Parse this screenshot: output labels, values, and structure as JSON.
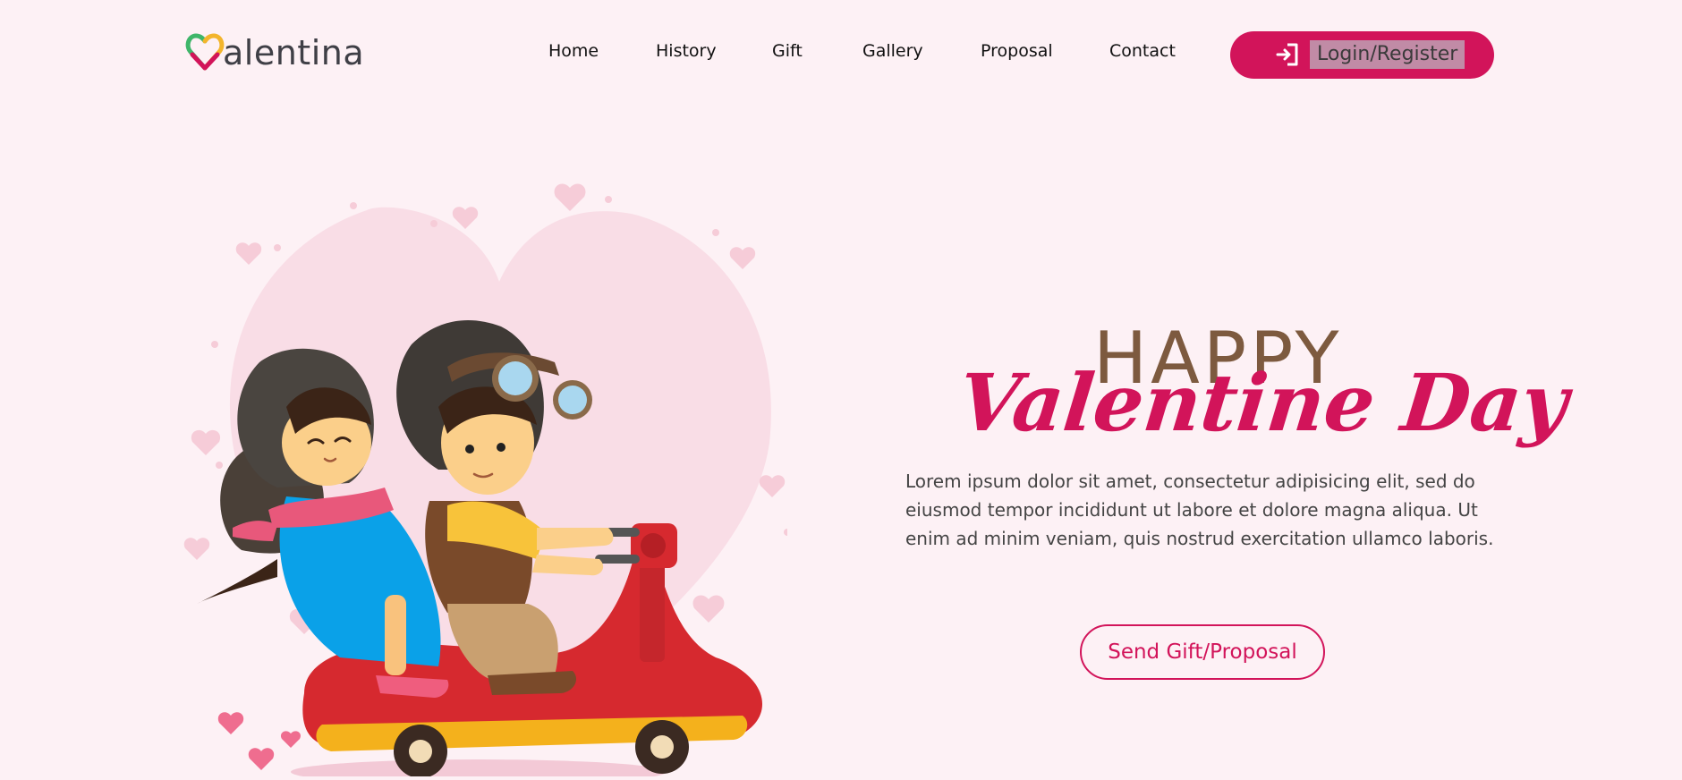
{
  "brand": {
    "logo_text": "alentina",
    "colors": {
      "primary": "#d2145a",
      "accent_brown": "#7d5a3f",
      "background": "#fdf1f5",
      "logo_green": "#3fb66a"
    }
  },
  "nav": {
    "items": [
      {
        "label": "Home"
      },
      {
        "label": "History"
      },
      {
        "label": "Gift"
      },
      {
        "label": "Gallery"
      },
      {
        "label": "Proposal"
      },
      {
        "label": "Contact"
      }
    ],
    "login": {
      "label": "Login/Register",
      "icon": "login-icon"
    }
  },
  "hero": {
    "eyebrow": "HAPPY",
    "title": "Valentine Day",
    "description": "Lorem ipsum dolor sit amet, consectetur adipisicing elit, sed do eiusmod tempor incididunt ut labore et dolore magna aliqua. Ut enim ad minim veniam, quis nostrud exercitation ullamco laboris.",
    "cta_label": "Send Gift/Proposal",
    "illustration": "couple-on-scooter-illustration"
  }
}
